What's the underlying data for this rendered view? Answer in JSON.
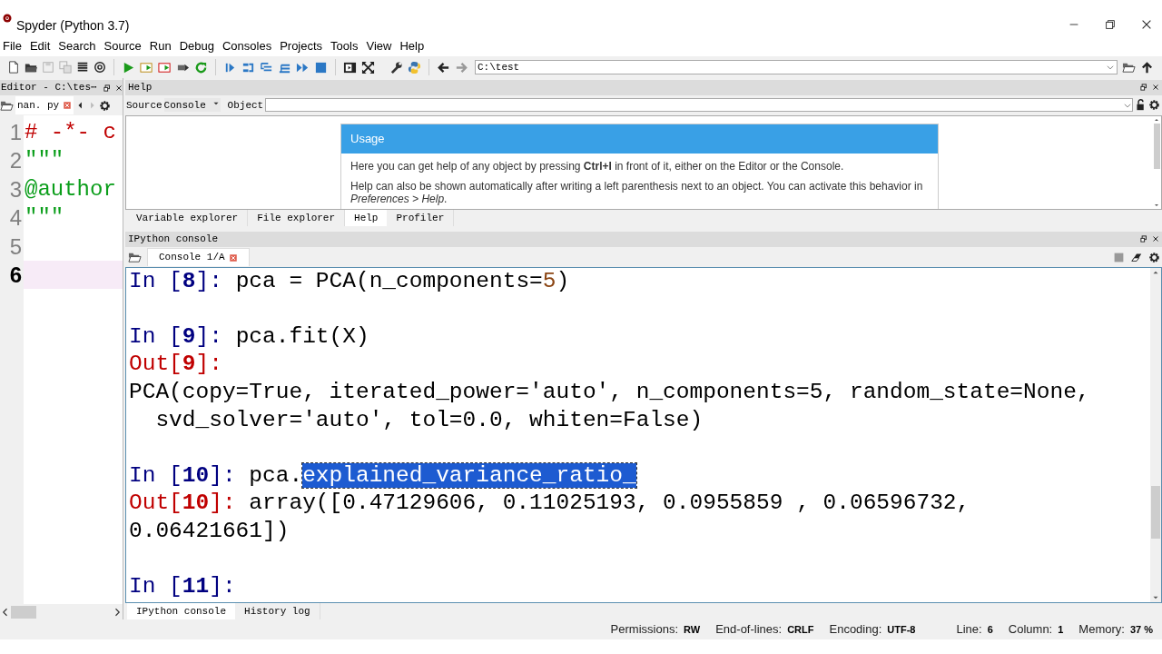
{
  "window": {
    "title": "Spyder (Python 3.7)"
  },
  "menu": [
    "File",
    "Edit",
    "Search",
    "Source",
    "Run",
    "Debug",
    "Consoles",
    "Projects",
    "Tools",
    "View",
    "Help"
  ],
  "toolbar": {
    "path": "C:\\test"
  },
  "editor": {
    "title": "Editor - C:\\tes⋯",
    "tab": "nan. py",
    "lines": [
      {
        "number": "1",
        "text": "# -*- c",
        "kind": "comment",
        "current": false
      },
      {
        "number": "2",
        "text": "\"\"\"",
        "kind": "string",
        "current": false
      },
      {
        "number": "3",
        "text": "@author",
        "kind": "string",
        "current": false
      },
      {
        "number": "4",
        "text": "\"\"\"",
        "kind": "string",
        "current": false
      },
      {
        "number": "5",
        "current": false
      },
      {
        "number": "6",
        "current": true
      }
    ]
  },
  "help": {
    "title": "Help",
    "source_label": "Source",
    "source_value": "Console",
    "object_label": "Object",
    "usage": {
      "heading": "Usage",
      "paragraphs": [
        "Here you can get help of any object by pressing **Ctrl+I** in front of it, either on the Editor or the Console.",
        "Help can also be shown automatically after writing a left parenthesis next to an object. You can activate this behavior in *Preferences > Help*."
      ]
    }
  },
  "pane_tabs": [
    {
      "label": "Variable explorer",
      "selected": false
    },
    {
      "label": "File explorer",
      "selected": false
    },
    {
      "label": "Help",
      "selected": true
    },
    {
      "label": "Profiler",
      "selected": false
    }
  ],
  "console": {
    "title": "IPython console",
    "tab": "Console 1/A",
    "lines": [
      {
        "kind": "text",
        "segments": [
          {
            "kind": "prompt_in",
            "text": "In [**8**]: "
          },
          {
            "kind": "code",
            "text": "pca = PCA(n_components="
          },
          {
            "kind": "number",
            "text": "5"
          },
          {
            "kind": "code",
            "text": ")"
          }
        ]
      },
      {
        "kind": "blank"
      },
      {
        "kind": "text",
        "segments": [
          {
            "kind": "prompt_in",
            "text": "In [**9**]: "
          },
          {
            "kind": "code",
            "text": "pca.fit(X)"
          }
        ]
      },
      {
        "kind": "text",
        "segments": [
          {
            "kind": "prompt_out",
            "text": "Out[**9**]:"
          }
        ]
      },
      {
        "kind": "text",
        "segments": [
          {
            "kind": "code",
            "text": "PCA(copy=True, iterated_power='auto', n_components=5, random_state=None,"
          }
        ]
      },
      {
        "kind": "text",
        "segments": [
          {
            "kind": "code",
            "text": "  svd_solver='auto', tol=0.0, whiten=False)"
          }
        ]
      },
      {
        "kind": "blank"
      },
      {
        "kind": "text",
        "segments": [
          {
            "kind": "prompt_in",
            "text": "In [**10**]: "
          },
          {
            "kind": "code",
            "text": "pca."
          },
          {
            "kind": "selected",
            "text": "explained_variance_ratio_"
          }
        ]
      },
      {
        "kind": "text",
        "segments": [
          {
            "kind": "prompt_out",
            "text": "Out[**10**]: "
          },
          {
            "kind": "code",
            "text": "array([0.47129606, 0.11025193, 0.0955859 , 0.06596732,"
          }
        ]
      },
      {
        "kind": "text",
        "segments": [
          {
            "kind": "code",
            "text": "0.06421661])"
          }
        ]
      },
      {
        "kind": "blank"
      },
      {
        "kind": "text",
        "segments": [
          {
            "kind": "prompt_in",
            "text": "In [**11**]: "
          }
        ]
      }
    ]
  },
  "bottom_tabs": [
    {
      "label": "IPython console",
      "selected": true
    },
    {
      "label": "History log",
      "selected": false
    }
  ],
  "status_bar": [
    {
      "label": "Permissions:",
      "value": "RW"
    },
    {
      "label": "End-of-lines:",
      "value": "CRLF"
    },
    {
      "label": "Encoding:",
      "value": "UTF-8"
    },
    {
      "label": "Line:",
      "value": "6"
    },
    {
      "label": "Column:",
      "value": "1"
    },
    {
      "label": "Memory:",
      "value": "37 %"
    }
  ]
}
